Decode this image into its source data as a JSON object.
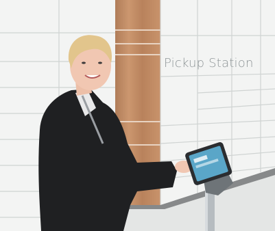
{
  "scene": {
    "description_kind": "photo",
    "sign_text": "Pickup Station",
    "colors": {
      "locker_panel": "#f3f4f3",
      "locker_seam": "#cfd3d2",
      "wood_panel": "#c48f68",
      "floor": "#e4e6e5",
      "jacket": "#1f2022",
      "hair": "#e2c58c",
      "skin": "#f1c7b2",
      "tablet_screen": "#5aa6c8",
      "kiosk_post": "#b6bcc0"
    }
  }
}
